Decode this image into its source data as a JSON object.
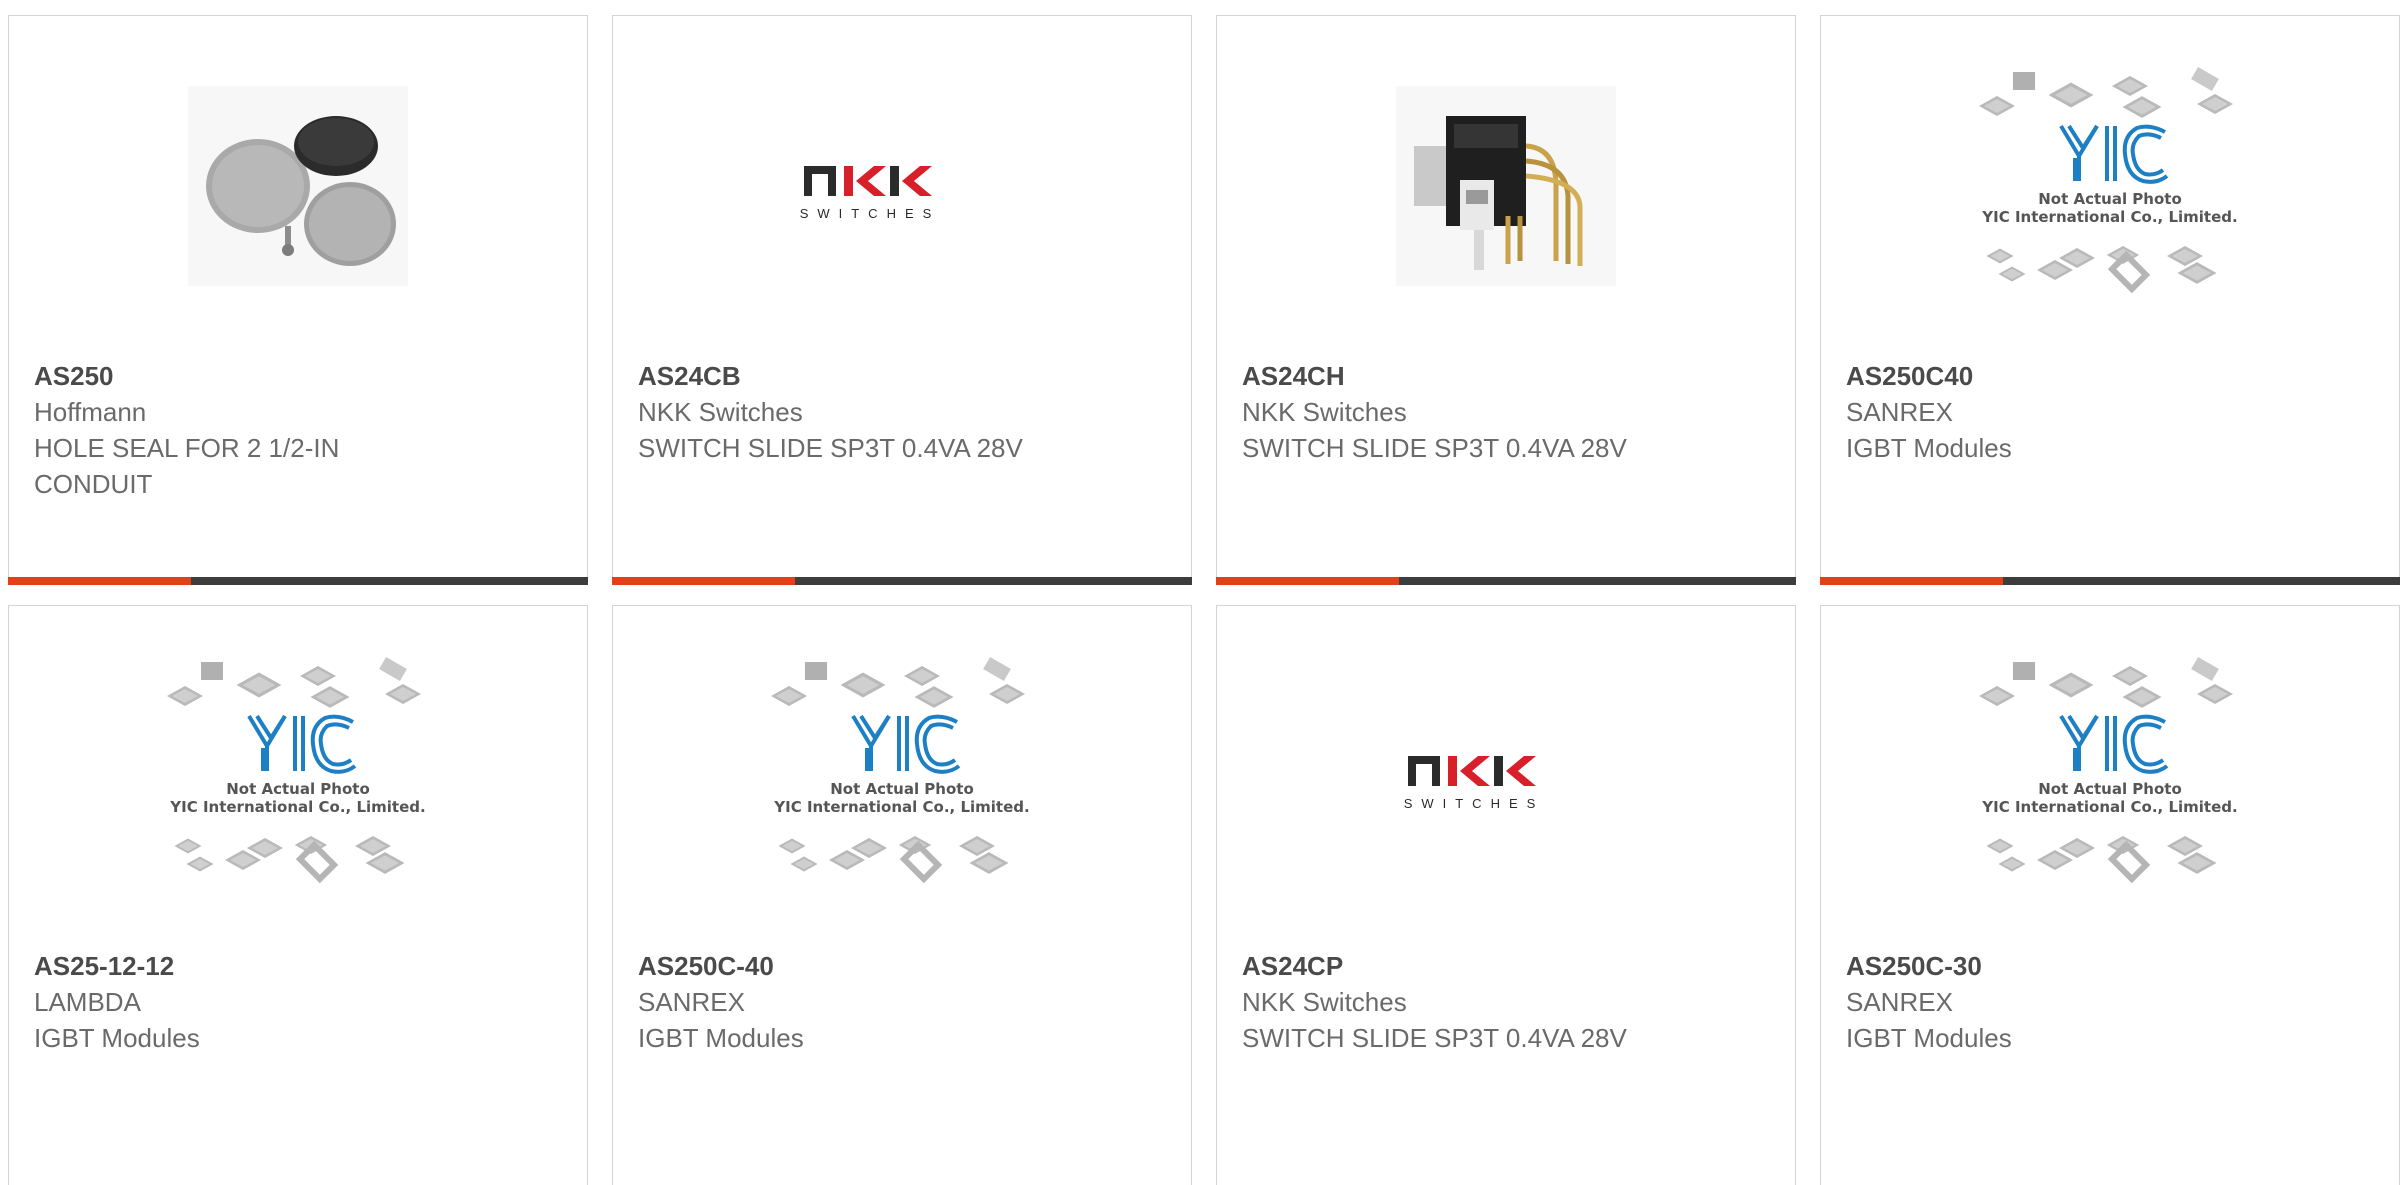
{
  "colors": {
    "accent": "#e23f1a",
    "bar": "#3d3d3d",
    "border": "#d4d4d4",
    "text": "#6a6a6a",
    "yic_blue": "#1d7fc4"
  },
  "placeholder": {
    "line1": "Not Actual Photo",
    "line2": "YIC International Co., Limited.",
    "logo_text": "YIC"
  },
  "nkk_logo": {
    "brand": "NKK",
    "sub": "SWITCHES"
  },
  "products": [
    {
      "part_number": "AS250",
      "manufacturer": "Hoffmann",
      "description": "HOLE SEAL FOR 2 1/2-IN CONDUIT",
      "image": "hole-seal-photo"
    },
    {
      "part_number": "AS24CB",
      "manufacturer": "NKK Switches",
      "description": "SWITCH SLIDE SP3T 0.4VA 28V",
      "image": "nkk-logo"
    },
    {
      "part_number": "AS24CH",
      "manufacturer": "NKK Switches",
      "description": "SWITCH SLIDE SP3T 0.4VA 28V",
      "image": "slide-switch-photo"
    },
    {
      "part_number": "AS250C40",
      "manufacturer": "SANREX",
      "description": "IGBT Modules",
      "image": "yic-placeholder"
    },
    {
      "part_number": "AS25-12-12",
      "manufacturer": "LAMBDA",
      "description": "IGBT Modules",
      "image": "yic-placeholder"
    },
    {
      "part_number": "AS250C-40",
      "manufacturer": "SANREX",
      "description": "IGBT Modules",
      "image": "yic-placeholder"
    },
    {
      "part_number": "AS24CP",
      "manufacturer": "NKK Switches",
      "description": "SWITCH SLIDE SP3T 0.4VA 28V",
      "image": "nkk-logo"
    },
    {
      "part_number": "AS250C-30",
      "manufacturer": "SANREX",
      "description": "IGBT Modules",
      "image": "yic-placeholder"
    }
  ]
}
